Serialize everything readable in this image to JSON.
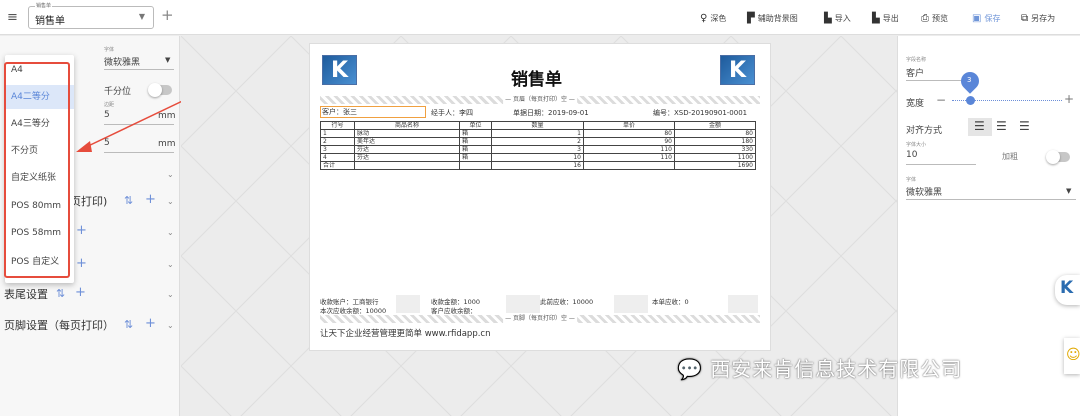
{
  "top": {
    "doc_select_label": "销售单",
    "doc_select_value": "销售单",
    "toolbar": [
      "深色",
      "辅助背景图",
      "导入",
      "导出",
      "预览",
      "保存",
      "另存为"
    ]
  },
  "left": {
    "font_label": "字体",
    "font_value": "微软雅黑",
    "thousand_label": "千分位",
    "margin_label": "边距",
    "margin_value": "5",
    "spacing_value": "5",
    "unit": "mm",
    "sections": [
      "页打印)",
      "表尾设置",
      "页脚设置（每页打印）"
    ]
  },
  "menu": {
    "items": [
      "A4",
      "A4二等分",
      "A4三等分",
      "不分页",
      "自定义纸张",
      "POS 80mm",
      "POS 58mm",
      "POS 自定义"
    ],
    "selected": "A4二等分"
  },
  "paper": {
    "title": "销售单",
    "header_sep": "— 页眉（每页打印）空 —",
    "customer": "客户：张三",
    "handler": "经手人：李四",
    "date": "单据日期：2019-09-01",
    "number": "编号：XSD-20190901-0001",
    "columns": [
      "行号",
      "商品名称",
      "单位",
      "数量",
      "单价",
      "金额"
    ],
    "rows": [
      [
        "1",
        "脉动",
        "箱",
        "1",
        "80",
        "80"
      ],
      [
        "2",
        "美年达",
        "箱",
        "2",
        "90",
        "180"
      ],
      [
        "3",
        "芬达",
        "箱",
        "3",
        "110",
        "330"
      ],
      [
        "4",
        "芬达",
        "箱",
        "10",
        "110",
        "1100"
      ]
    ],
    "total_label": "合计",
    "total_qty": "16",
    "total_amount": "1690",
    "footer": {
      "account": "收款账户：工商银行",
      "receivable_balance": "本次应收余额：10000",
      "received": "收款金额：1000",
      "customer_balance": "客户应收余额：",
      "prior_receivable": "此前应收：10000",
      "current_receivable": "本单应收：0"
    },
    "footer_sep": "— 页脚（每页打印）空 —",
    "slogan": "让天下企业经营管理更简单 www.rfidapp.cn"
  },
  "right": {
    "field_name_label": "字段名称",
    "field_name": "客户",
    "width_label": "宽度",
    "slider_value": "3",
    "align_label": "对齐方式",
    "font_size_label": "字体大小",
    "font_size": "10",
    "bold_label": "加粗",
    "font_label": "字体",
    "font_value": "微软雅黑"
  },
  "watermark": "西安来肯信息技术有限公司",
  "colors": {
    "accent": "#5a86d8",
    "annotation": "#e64c3c"
  }
}
